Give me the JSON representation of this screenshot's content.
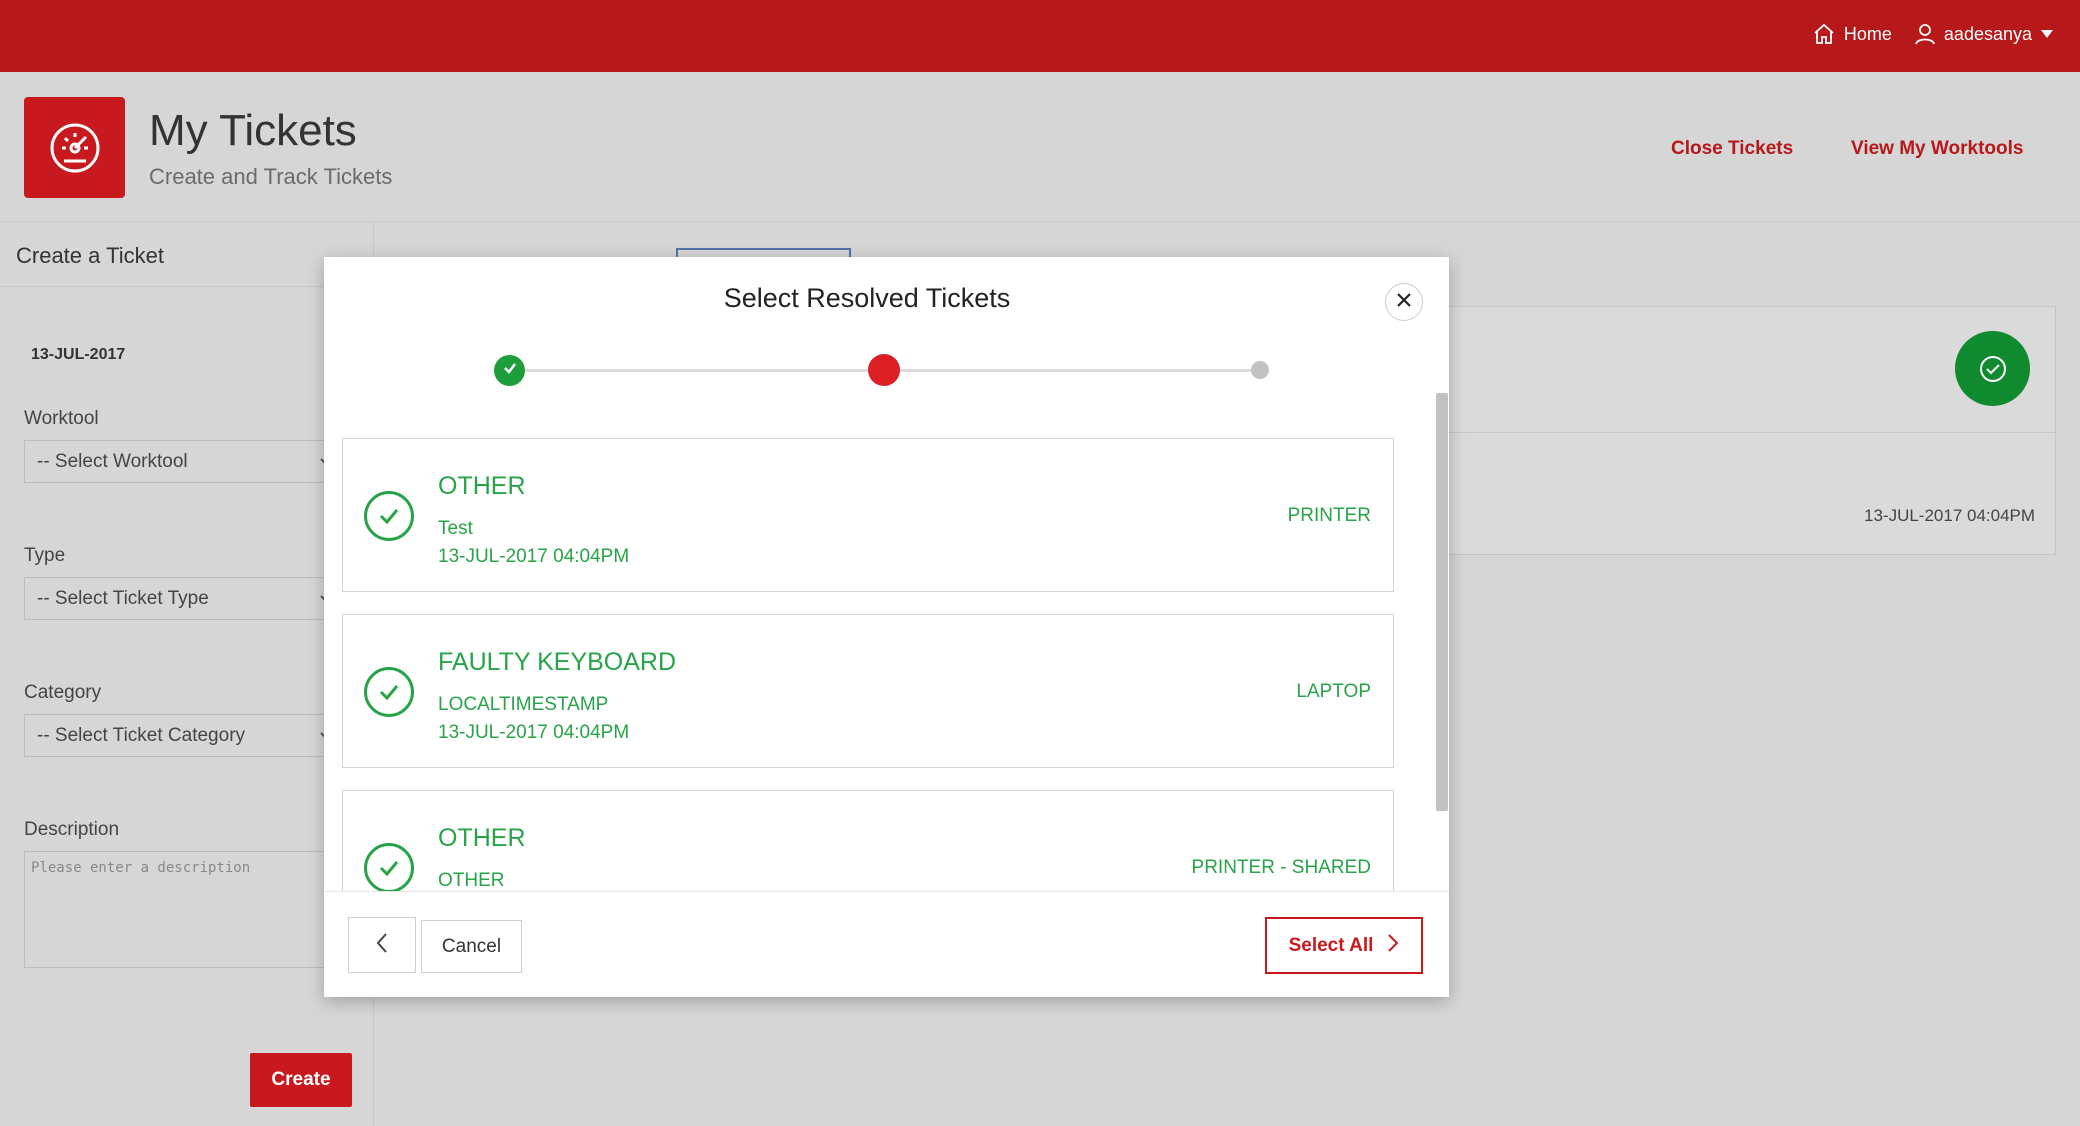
{
  "topnav": {
    "home_label": "Home",
    "user_label": "aadesanya"
  },
  "header": {
    "title": "My Tickets",
    "subtitle": "Create and Track Tickets",
    "links": [
      "Close Tickets",
      "View My Worktools"
    ]
  },
  "create_form": {
    "title": "Create a Ticket",
    "date": "13-JUL-2017",
    "worktool": {
      "label": "Worktool",
      "value": "-- Select Worktool"
    },
    "type": {
      "label": "Type",
      "value": "-- Select Ticket Type"
    },
    "category": {
      "label": "Category",
      "value": "-- Select Ticket Category"
    },
    "description": {
      "label": "Description",
      "placeholder": "Please enter a description"
    },
    "create_label": "Create"
  },
  "background": {
    "ticket_date": "13-JUL-2017 04:04PM"
  },
  "modal": {
    "title": "Select Resolved Tickets",
    "progress": {
      "current_step": 2,
      "total_steps": 3
    },
    "tickets": [
      {
        "title": "OTHER",
        "line1": "Test",
        "line2": "13-JUL-2017 04:04PM",
        "tag": "PRINTER"
      },
      {
        "title": "FAULTY KEYBOARD",
        "line1": "LOCALTIMESTAMP",
        "line2": "13-JUL-2017 04:04PM",
        "tag": "LAPTOP"
      },
      {
        "title": "OTHER",
        "line1": "OTHER",
        "line2": "",
        "tag": "PRINTER - SHARED"
      }
    ],
    "cancel_label": "Cancel",
    "select_all_label": "Select All"
  },
  "colors": {
    "brand": "#b71819",
    "accent_red": "#c8191e",
    "success": "#27a348",
    "step_done": "#1e9e3b"
  }
}
